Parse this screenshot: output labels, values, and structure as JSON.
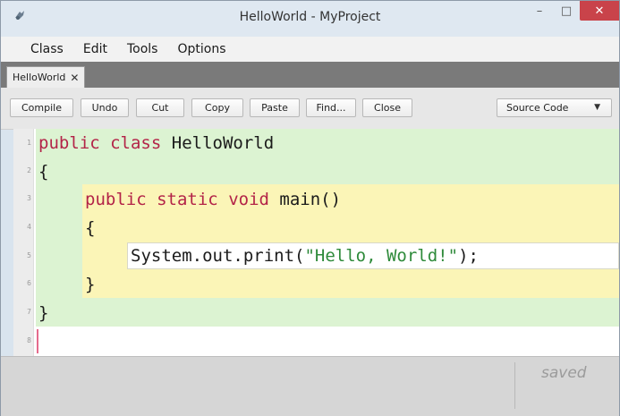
{
  "window": {
    "title": "HelloWorld - MyProject",
    "controls": {
      "minimize": "–",
      "maximize": "□",
      "close": "✕"
    }
  },
  "menu": [
    "Class",
    "Edit",
    "Tools",
    "Options"
  ],
  "tabs": [
    {
      "label": "HelloWorld",
      "close": "✕"
    }
  ],
  "toolbar": {
    "buttons": [
      "Compile",
      "Undo",
      "Cut",
      "Copy",
      "Paste",
      "Find...",
      "Close"
    ],
    "view_select": {
      "value": "Source Code",
      "arrow": "▼"
    }
  },
  "editor": {
    "line_numbers": [
      "1",
      "2",
      "3",
      "4",
      "5",
      "6",
      "7",
      "8"
    ],
    "lines": {
      "l1_kw1": "public",
      "l1_kw2": "class",
      "l1_name": "HelloWorld",
      "l2": "{",
      "l3_kw1": "public",
      "l3_kw2": "static",
      "l3_kw3": "void",
      "l3_rest": "main()",
      "l4": "{",
      "l5_pre": "System.out.print(",
      "l5_str": "\"Hello, World!\"",
      "l5_post": ");",
      "l6": "}",
      "l7": "}"
    }
  },
  "status": {
    "text": "saved"
  },
  "colors": {
    "class_scope": "#dcf3d2",
    "method_scope": "#fbf5b7",
    "keyword": "#b32448",
    "string": "#2e8a3a",
    "close_button": "#c9434a"
  }
}
